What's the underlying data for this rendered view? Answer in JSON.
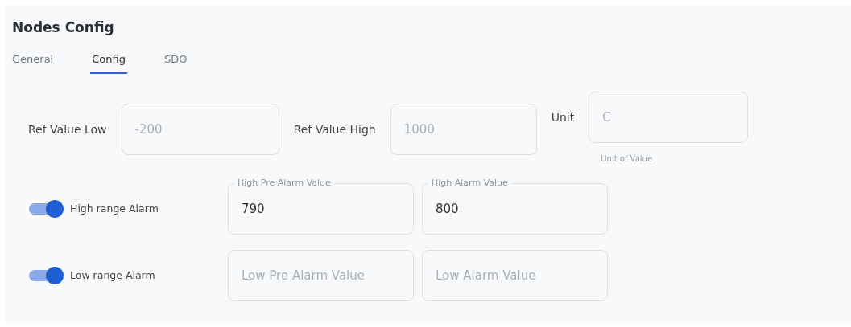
{
  "title": "Nodes Config",
  "tabs": [
    {
      "label": "General",
      "selected": false
    },
    {
      "label": "Config",
      "selected": true
    },
    {
      "label": "SDO",
      "selected": false
    }
  ],
  "ref_fields": [
    {
      "label": "Ref Value Low",
      "placeholder": "-200"
    },
    {
      "label": "Ref Value High",
      "placeholder": "1000"
    },
    {
      "label": "Unit",
      "placeholder": "C",
      "helper": "Unit of Value"
    }
  ],
  "alarms": [
    {
      "label": "High range Alarm",
      "on": true,
      "fields": [
        {
          "label": "High Pre Alarm Value",
          "value": "790"
        },
        {
          "label": "High Alarm Value",
          "value": "800"
        }
      ]
    },
    {
      "label": "Low range Alarm",
      "on": true,
      "fields": [
        {
          "placeholder": "Low Pre Alarm Value"
        },
        {
          "placeholder": "Low Alarm Value"
        }
      ]
    }
  ]
}
